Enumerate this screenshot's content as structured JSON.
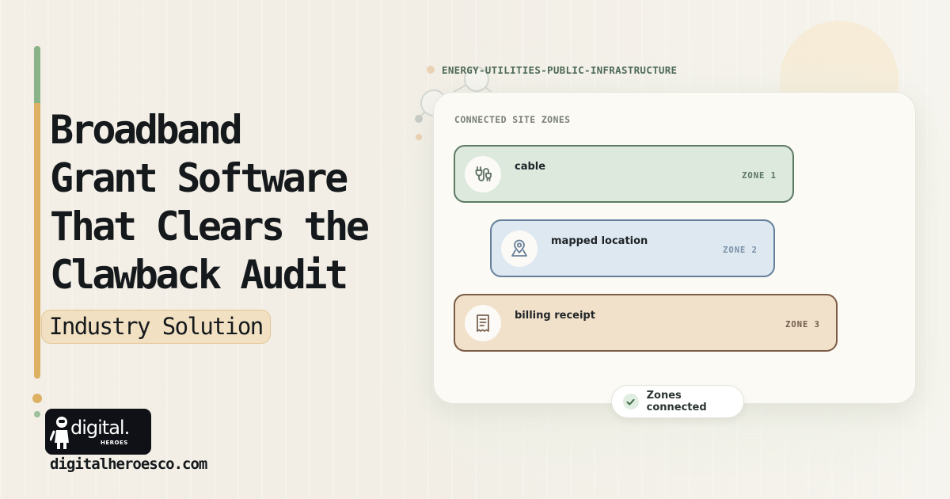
{
  "headline": {
    "line1": "Broadband",
    "line2": "Grant Software",
    "line3": "That Clears the",
    "line4": "Clawback Audit"
  },
  "category_pill": "Industry Solution",
  "brand": {
    "logo_word": "digital.",
    "logo_sub": "HEROES",
    "url": "digitalheroesco.com"
  },
  "industry_label": "ENERGY-UTILITIES-PUBLIC-INFRASTRUCTURE",
  "panel": {
    "title": "CONNECTED SITE ZONES",
    "zones": [
      {
        "name": "cable",
        "tag": "ZONE 1",
        "icon": "plug-icon"
      },
      {
        "name": "mapped location",
        "tag": "ZONE 2",
        "icon": "map-pin-icon"
      },
      {
        "name": "billing receipt",
        "tag": "ZONE 3",
        "icon": "receipt-icon"
      }
    ],
    "status": "Zones connected"
  },
  "colors": {
    "accent_gold": "#deb064",
    "accent_green": "#8ab38a",
    "zone1_bg": "#dde9dd",
    "zone2_bg": "#dde8f0",
    "zone3_bg": "#f2e1ca"
  }
}
